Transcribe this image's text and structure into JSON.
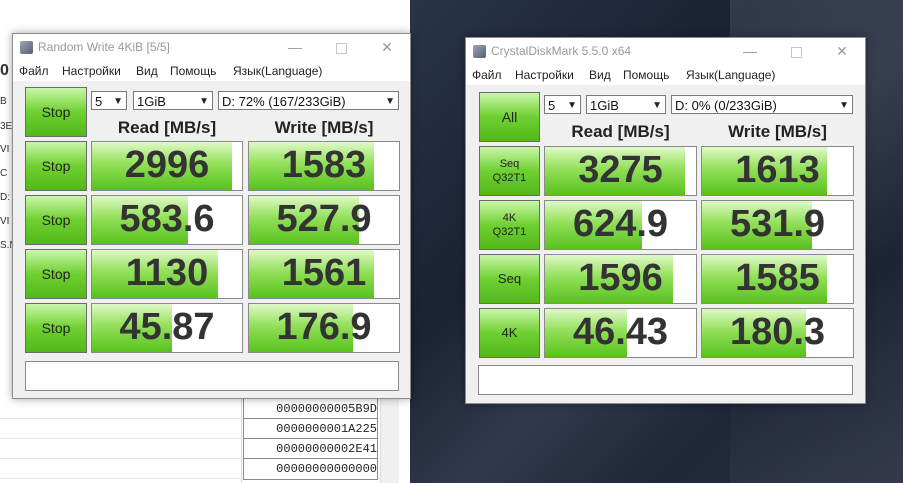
{
  "background": {
    "side_labels": [
      "0",
      "B",
      "3E",
      "VI",
      "C",
      "D:",
      "VI",
      "S.N"
    ],
    "table_values": [
      "00000000005B9D",
      "0000000001A225",
      "00000000002E41",
      "00000000000000"
    ]
  },
  "window1": {
    "title": "Random Write 4KiB [5/5]",
    "menu": [
      "Файл",
      "Настройки",
      "Вид",
      "Помощь",
      "Язык(Language)"
    ],
    "main_button": "Stop",
    "count": "5",
    "size": "1GiB",
    "drive": "D: 72% (167/233GiB)",
    "headers": {
      "read": "Read [MB/s]",
      "write": "Write [MB/s]"
    },
    "rows": [
      {
        "button": "Stop",
        "read": "2996",
        "write": "1583",
        "read_fill": 0.93,
        "write_fill": 0.83
      },
      {
        "button": "Stop",
        "read": "583.6",
        "write": "527.9",
        "read_fill": 0.64,
        "write_fill": 0.73
      },
      {
        "button": "Stop",
        "read": "1130",
        "write": "1561",
        "read_fill": 0.84,
        "write_fill": 0.83
      },
      {
        "button": "Stop",
        "read": "45.87",
        "write": "176.9",
        "read_fill": 0.53,
        "write_fill": 0.69
      }
    ]
  },
  "window2": {
    "title": "CrystalDiskMark 5.5.0 x64",
    "menu": [
      "Файл",
      "Настройки",
      "Вид",
      "Помощь",
      "Язык(Language)"
    ],
    "main_button": "All",
    "count": "5",
    "size": "1GiB",
    "drive": "D: 0% (0/233GiB)",
    "headers": {
      "read": "Read [MB/s]",
      "write": "Write [MB/s]"
    },
    "rows": [
      {
        "button": [
          "Seq",
          "Q32T1"
        ],
        "read": "3275",
        "write": "1613",
        "read_fill": 0.93,
        "write_fill": 0.83
      },
      {
        "button": [
          "4K",
          "Q32T1"
        ],
        "read": "624.9",
        "write": "531.9",
        "read_fill": 0.64,
        "write_fill": 0.73
      },
      {
        "button": [
          "Seq"
        ],
        "read": "1596",
        "write": "1585",
        "read_fill": 0.85,
        "write_fill": 0.83
      },
      {
        "button": [
          "4K"
        ],
        "read": "46.43",
        "write": "180.3",
        "read_fill": 0.54,
        "write_fill": 0.69
      }
    ]
  },
  "colors": {
    "green_dark": "#53b81a",
    "green_light": "#caf7aa",
    "value_text": "#333333"
  }
}
